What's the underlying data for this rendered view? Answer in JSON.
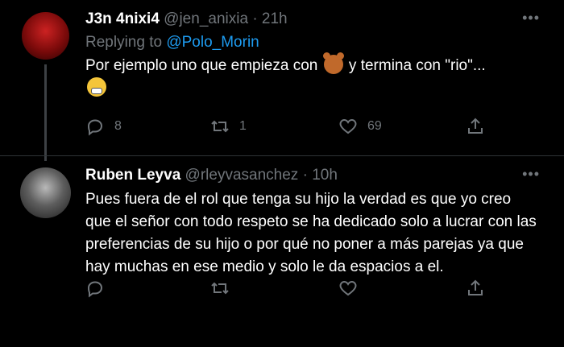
{
  "tweets": [
    {
      "name": "J3n 4nixi4",
      "handle": "@jen_anixia",
      "time": "21h",
      "replying_to_prefix": "Replying to",
      "replying_to_handle": "@Polo_Morin",
      "text_part1": "Por ejemplo uno que empieza con",
      "text_part2": "y termina con \"rio\"...",
      "emojis": [
        "bear-face",
        "grimacing-face"
      ],
      "replies": "8",
      "retweets": "1",
      "likes": "69"
    },
    {
      "name": "Ruben Leyva",
      "handle": "@rleyvasanchez",
      "time": "10h",
      "text": "Pues fuera de el rol que tenga su hijo la verdad es que yo creo que el señor con todo respeto se ha dedicado solo a lucrar con las preferencias de su hijo o por qué no poner a más parejas ya que hay muchas en ese medio y solo le da espacios a el.",
      "replies": "",
      "retweets": "",
      "likes": ""
    }
  ],
  "icons": {
    "more": "more-horizontal-icon",
    "reply": "reply-icon",
    "retweet": "retweet-icon",
    "like": "heart-icon",
    "share": "share-icon"
  },
  "colors": {
    "background": "#000000",
    "secondary_text": "#71767b",
    "link": "#1d9bf0"
  }
}
